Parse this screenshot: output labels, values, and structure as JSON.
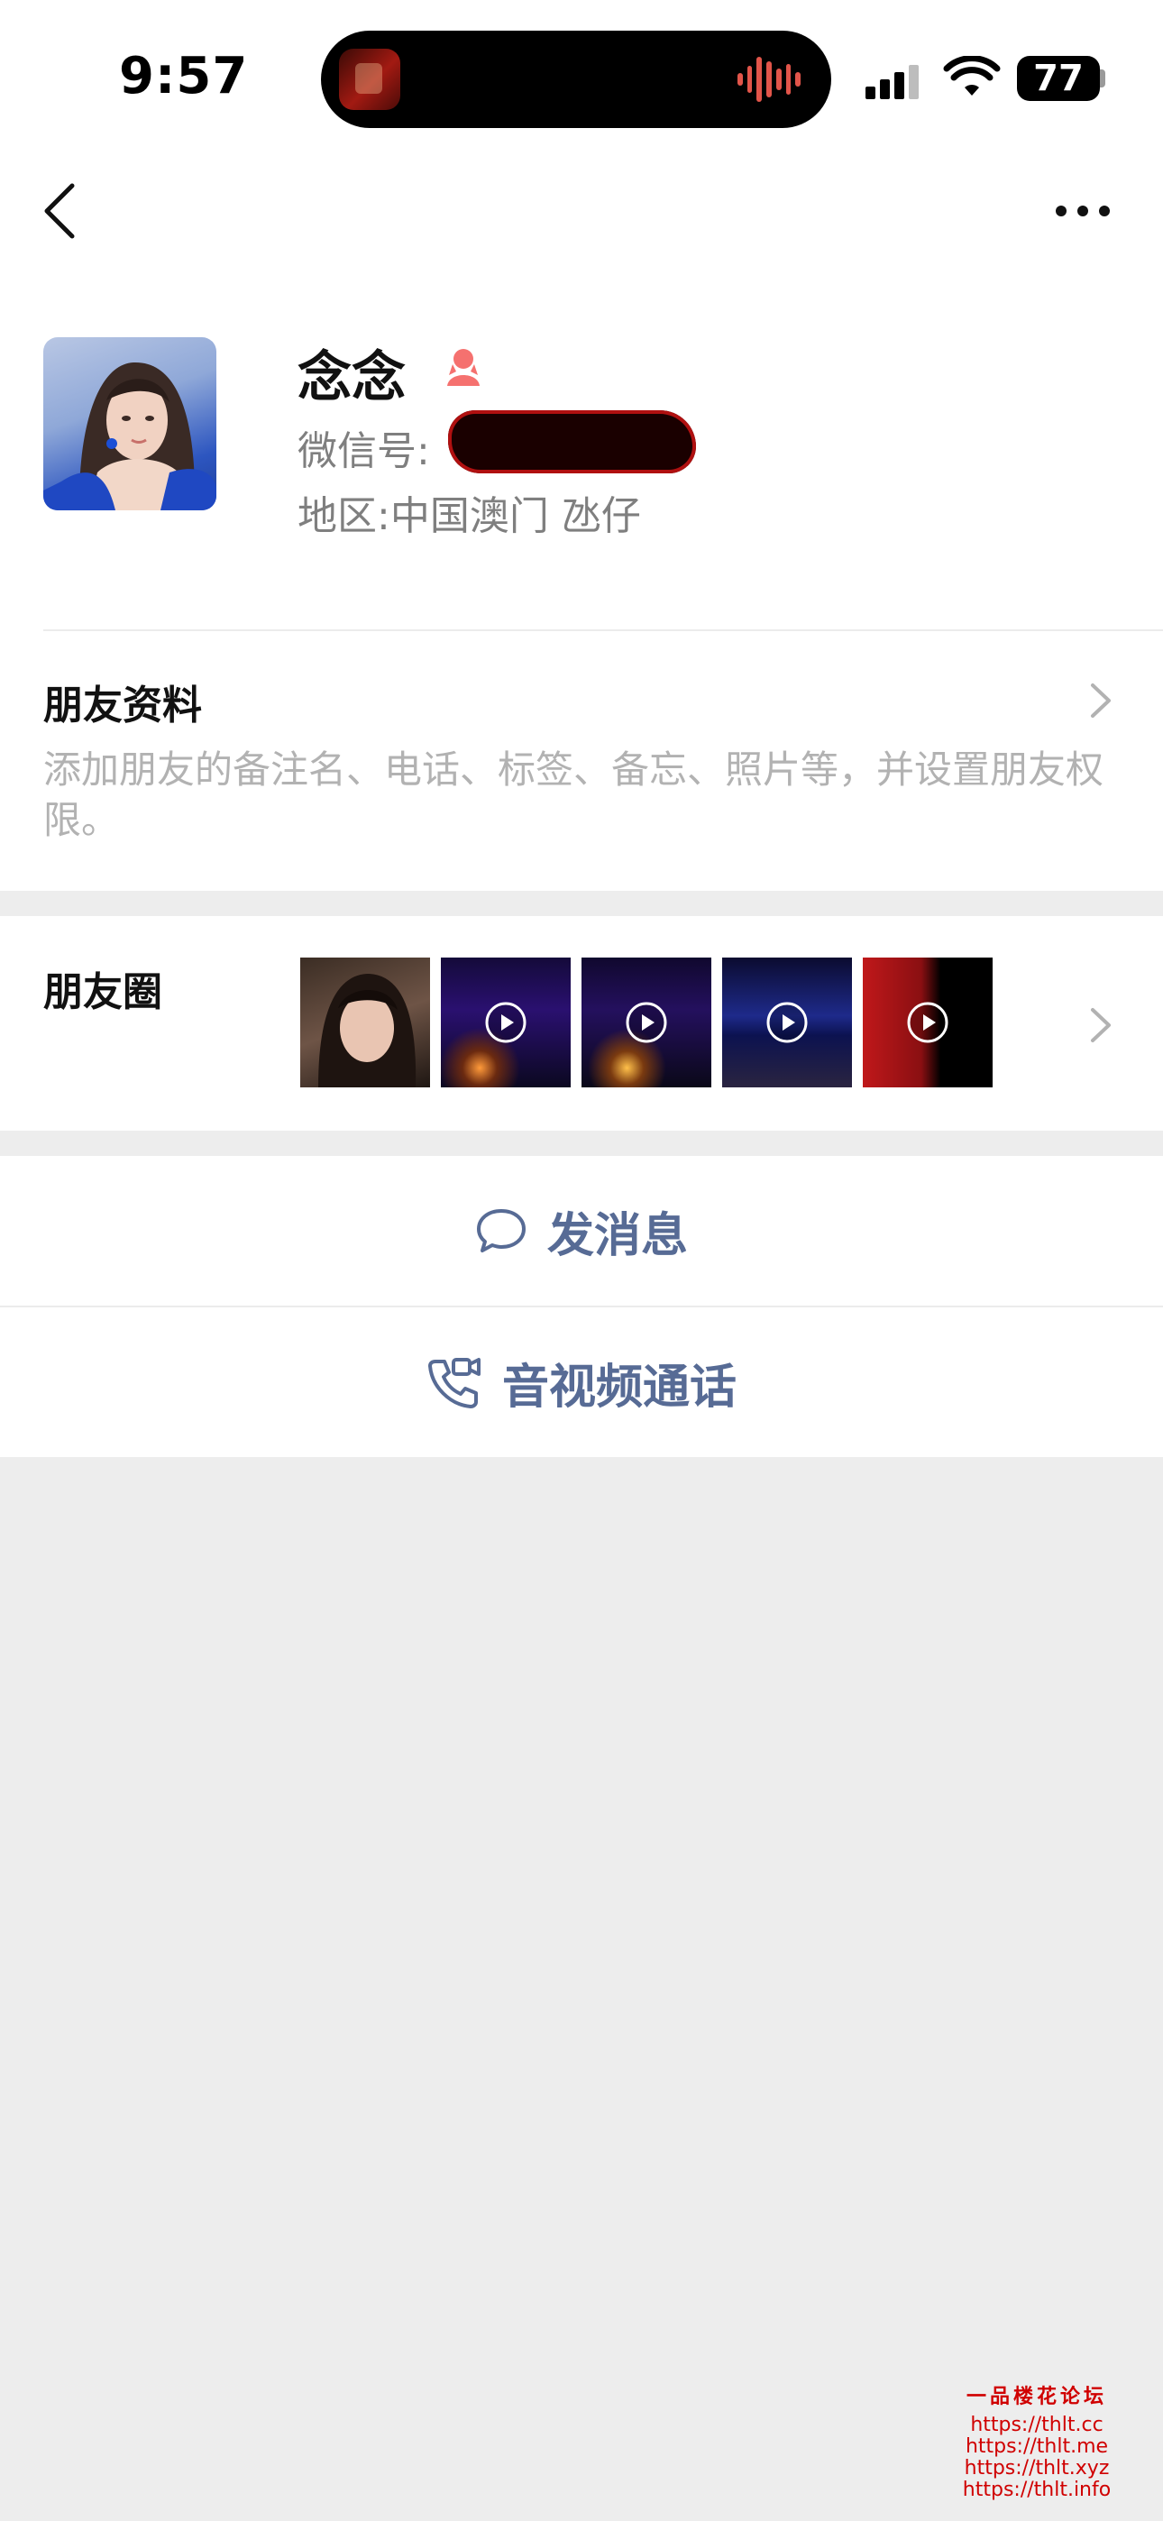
{
  "status_bar": {
    "time": "9:57",
    "battery": "77"
  },
  "profile": {
    "name": "念念",
    "wechat_id_label": "微信号:",
    "region_label": "地区:中国澳门 氹仔"
  },
  "friend_info": {
    "title": "朋友资料",
    "description": "添加朋友的备注名、电话、标签、备忘、照片等，并设置朋友权限。"
  },
  "moments": {
    "title": "朋友圈"
  },
  "actions": {
    "send_message": "发消息",
    "av_call": "音视频通话"
  },
  "watermark": {
    "title": "一品楼花论坛",
    "urls": [
      "https://thlt.cc",
      "https://thlt.me",
      "https://thlt.xyz",
      "https://thlt.info"
    ]
  },
  "colors": {
    "link_blue": "#576b95",
    "gender_female": "#f5716f",
    "background": "#ededed"
  }
}
